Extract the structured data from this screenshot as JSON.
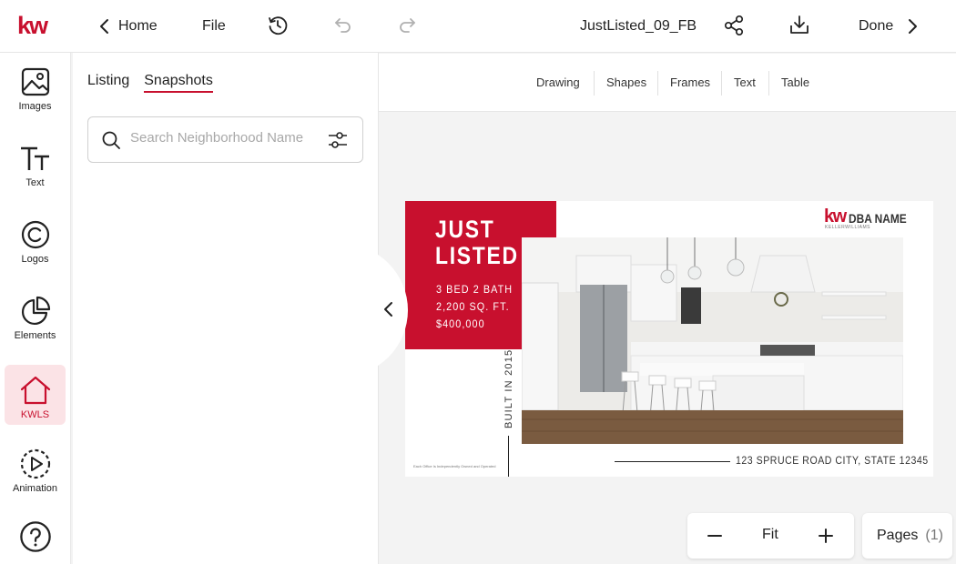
{
  "topbar": {
    "logo": "kw",
    "home_label": "Home",
    "file_label": "File",
    "document_name": "JustListed_09_FB",
    "done_label": "Done"
  },
  "rail": {
    "items": [
      {
        "label": "Images",
        "icon": "image-icon"
      },
      {
        "label": "Text",
        "icon": "text-icon"
      },
      {
        "label": "Logos",
        "icon": "copyright-icon"
      },
      {
        "label": "Elements",
        "icon": "pie-chart-icon"
      },
      {
        "label": "KWLS",
        "icon": "house-icon",
        "active": true
      },
      {
        "label": "Animation",
        "icon": "play-circle-icon"
      },
      {
        "label": "",
        "icon": "help-icon"
      }
    ]
  },
  "panel": {
    "tabs": [
      {
        "label": "Listing",
        "active": false
      },
      {
        "label": "Snapshots",
        "active": true
      }
    ],
    "search_placeholder": "Search Neighborhood Name"
  },
  "subbar": {
    "items": [
      "Drawing",
      "Shapes",
      "Frames",
      "Text",
      "Table"
    ]
  },
  "design": {
    "headline_1": "JUST",
    "headline_2": "LISTED",
    "beds_baths": "3 BED 2 BATH",
    "sqft": "2,200 SQ. FT.",
    "price": "$400,000",
    "built": "BUILT IN 2015",
    "address": "123 SPRUCE ROAD CITY, STATE 12345",
    "brand_kw": "kw",
    "brand_name": "DBA NAME",
    "brand_sub": "KELLERWILLIAMS",
    "fine_print": "Each Office Is Independently Owned and Operated"
  },
  "zoom": {
    "fit_label": "Fit"
  },
  "pages": {
    "label": "Pages",
    "count": "(1)"
  },
  "colors": {
    "brand_red": "#c8102e",
    "active_bg": "#fbe3e6"
  }
}
